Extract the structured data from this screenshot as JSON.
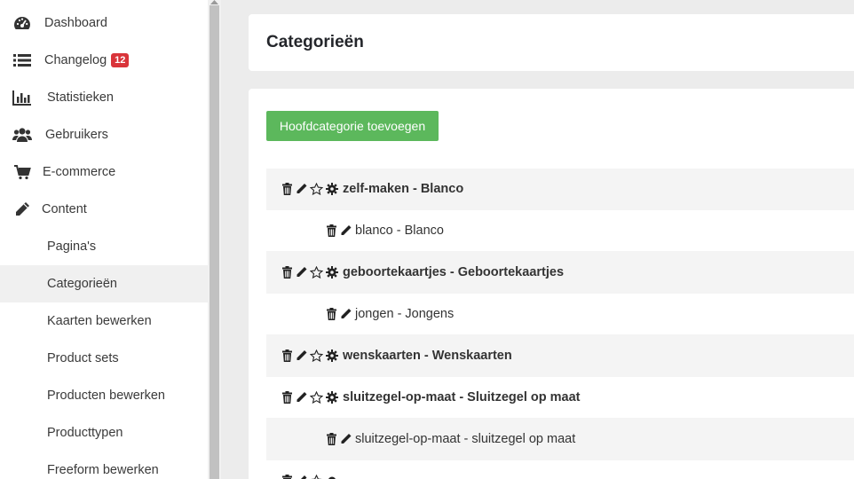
{
  "sidebar": {
    "items": [
      {
        "label": "Dashboard",
        "icon": "dashboard-icon"
      },
      {
        "label": "Changelog",
        "icon": "list-icon",
        "badge": "12"
      },
      {
        "label": "Statistieken",
        "icon": "bar-chart-icon"
      },
      {
        "label": "Gebruikers",
        "icon": "users-icon"
      },
      {
        "label": "E-commerce",
        "icon": "cart-icon"
      },
      {
        "label": "Content",
        "icon": "pencil-icon"
      }
    ],
    "sub_items": [
      {
        "label": "Pagina's"
      },
      {
        "label": "Categorieën",
        "active": true
      },
      {
        "label": "Kaarten bewerken"
      },
      {
        "label": "Product sets"
      },
      {
        "label": "Producten bewerken"
      },
      {
        "label": "Producttypen"
      },
      {
        "label": "Freeform bewerken"
      }
    ]
  },
  "header": {
    "title": "Categorieën"
  },
  "main": {
    "add_button": "Hoofdcategorie toevoegen",
    "categories": [
      {
        "level": "parent",
        "text": "zelf-maken - Blanco"
      },
      {
        "level": "child",
        "text": "blanco - Blanco"
      },
      {
        "level": "parent",
        "text": "geboortekaartjes - Geboortekaartjes"
      },
      {
        "level": "child",
        "text": "jongen - Jongens"
      },
      {
        "level": "parent",
        "text": "wenskaarten - Wenskaarten"
      },
      {
        "level": "parent",
        "text": "sluitzegel-op-maat - Sluitzegel op maat"
      },
      {
        "level": "child",
        "text": "sluitzegel-op-maat - sluitzegel op maat"
      }
    ]
  },
  "colors": {
    "accent_green": "#5cb85c",
    "badge_red": "#d9343a",
    "active_bg": "#f0f0f0"
  }
}
